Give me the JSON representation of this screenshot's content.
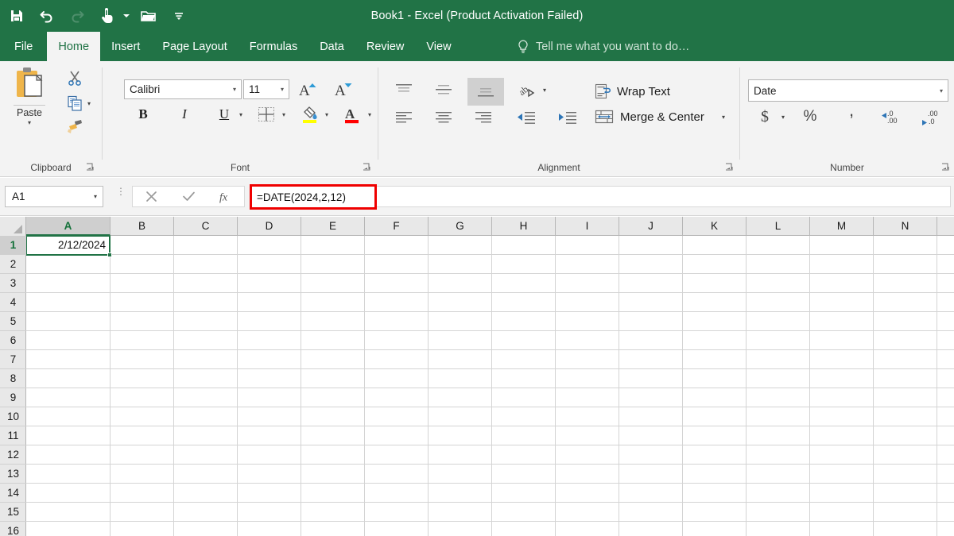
{
  "titlebar": {
    "title": "Book1 - Excel (Product Activation Failed)",
    "qat": [
      {
        "name": "save-icon",
        "label": "Save"
      },
      {
        "name": "undo-icon",
        "label": "Undo"
      },
      {
        "name": "redo-icon",
        "label": "Redo"
      },
      {
        "name": "touch-mouse-mode-icon",
        "label": "Touch/Mouse Mode"
      },
      {
        "name": "open-folder-icon",
        "label": "Open"
      },
      {
        "name": "customize-quick-access-toolbar-icon",
        "label": "Customize Quick Access Toolbar"
      }
    ]
  },
  "tabs": [
    {
      "label": "File",
      "active": false
    },
    {
      "label": "Home",
      "active": true
    },
    {
      "label": "Insert",
      "active": false
    },
    {
      "label": "Page Layout",
      "active": false
    },
    {
      "label": "Formulas",
      "active": false
    },
    {
      "label": "Data",
      "active": false
    },
    {
      "label": "Review",
      "active": false
    },
    {
      "label": "View",
      "active": false
    }
  ],
  "tellme": {
    "placeholder": "Tell me what you want to do…",
    "icon": "lightbulb-icon"
  },
  "ribbon": {
    "groups": [
      {
        "name": "clipboard",
        "label": "Clipboard"
      },
      {
        "name": "font",
        "label": "Font"
      },
      {
        "name": "alignment",
        "label": "Alignment"
      },
      {
        "name": "number",
        "label": "Number"
      }
    ],
    "clipboard": {
      "paste_label": "Paste",
      "cut_label": "Cut",
      "copy_label": "Copy",
      "format_painter_label": "Format Painter"
    },
    "font": {
      "font_name": "Calibri",
      "font_size": "11",
      "grow_font_label": "Increase Font Size",
      "shrink_font_label": "Decrease Font Size",
      "bold_label": "B",
      "italic_label": "I",
      "underline_label": "U",
      "borders_label": "Borders",
      "fill_color_label": "Fill Color",
      "fill_color": "#ffff00",
      "font_color_label": "Font Color",
      "font_color": "#ff0000"
    },
    "alignment": {
      "top_align_label": "Top Align",
      "middle_align_label": "Middle Align",
      "bottom_align_label": "Bottom Align",
      "bottom_align_selected": true,
      "orientation_label": "Orientation",
      "align_left_label": "Align Left",
      "center_label": "Center",
      "align_right_label": "Align Right",
      "decrease_indent_label": "Decrease Indent",
      "increase_indent_label": "Increase Indent",
      "wrap_text_label": "Wrap Text",
      "merge_center_label": "Merge & Center"
    },
    "number": {
      "format_value": "Date",
      "accounting_label": "Accounting Number Format",
      "percent_label": "Percent Style",
      "comma_label": "Comma Style",
      "increase_decimal_label": "Increase Decimal",
      "decrease_decimal_label": "Decrease Decimal"
    }
  },
  "formulabar": {
    "name_box_value": "A1",
    "cancel_label": "Cancel",
    "enter_label": "Enter",
    "insert_function_label": "Insert Function",
    "formula_value": "=DATE(2024,2,12)",
    "highlight_color": "#ef0000"
  },
  "grid": {
    "columns": [
      "A",
      "B",
      "C",
      "D",
      "E",
      "F",
      "G",
      "H",
      "I",
      "J",
      "K",
      "L",
      "M",
      "N"
    ],
    "rows": [
      "1",
      "2",
      "3",
      "4",
      "5",
      "6",
      "7",
      "8",
      "9",
      "10",
      "11",
      "12",
      "13",
      "14",
      "15",
      "16"
    ],
    "selected_cell": "A1",
    "selected_column": "A",
    "selected_row": "1",
    "cells": [
      {
        "ref": "A1",
        "col": 0,
        "row": 0,
        "value": "2/12/2024"
      }
    ],
    "selection_color": "#217346"
  }
}
